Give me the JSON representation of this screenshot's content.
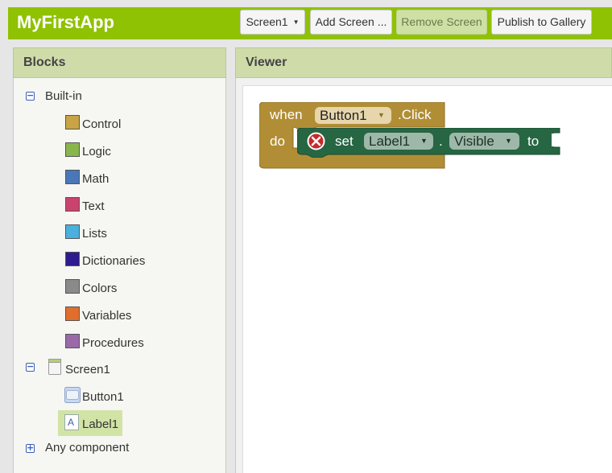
{
  "app": {
    "title": "MyFirstApp"
  },
  "toolbar": {
    "screen_select": "Screen1",
    "add_screen": "Add Screen ...",
    "remove_screen": "Remove Screen",
    "publish": "Publish to Gallery"
  },
  "blocks_panel": {
    "title": "Blocks",
    "builtin": {
      "label": "Built-in",
      "items": [
        {
          "label": "Control",
          "color": "#c8a447"
        },
        {
          "label": "Logic",
          "color": "#8ab54c"
        },
        {
          "label": "Math",
          "color": "#4a77b8"
        },
        {
          "label": "Text",
          "color": "#c9436e"
        },
        {
          "label": "Lists",
          "color": "#4ab0de"
        },
        {
          "label": "Dictionaries",
          "color": "#2e1b8f"
        },
        {
          "label": "Colors",
          "color": "#8a8a8a"
        },
        {
          "label": "Variables",
          "color": "#e06e2d"
        },
        {
          "label": "Procedures",
          "color": "#9a6aa8"
        }
      ]
    },
    "screen": {
      "label": "Screen1",
      "children": [
        {
          "label": "Button1",
          "icon": "button-icon"
        },
        {
          "label": "Label1",
          "icon": "label-icon",
          "selected": true
        }
      ]
    },
    "any_component": {
      "label": "Any component"
    }
  },
  "viewer": {
    "title": "Viewer",
    "event_block": {
      "when": "when",
      "component": "Button1",
      "event": ".Click",
      "do": "do",
      "color": "#b18e35"
    },
    "setter_block": {
      "set": "set",
      "component": "Label1",
      "dot": ".",
      "property": "Visible",
      "to": "to",
      "color": "#266643"
    }
  }
}
